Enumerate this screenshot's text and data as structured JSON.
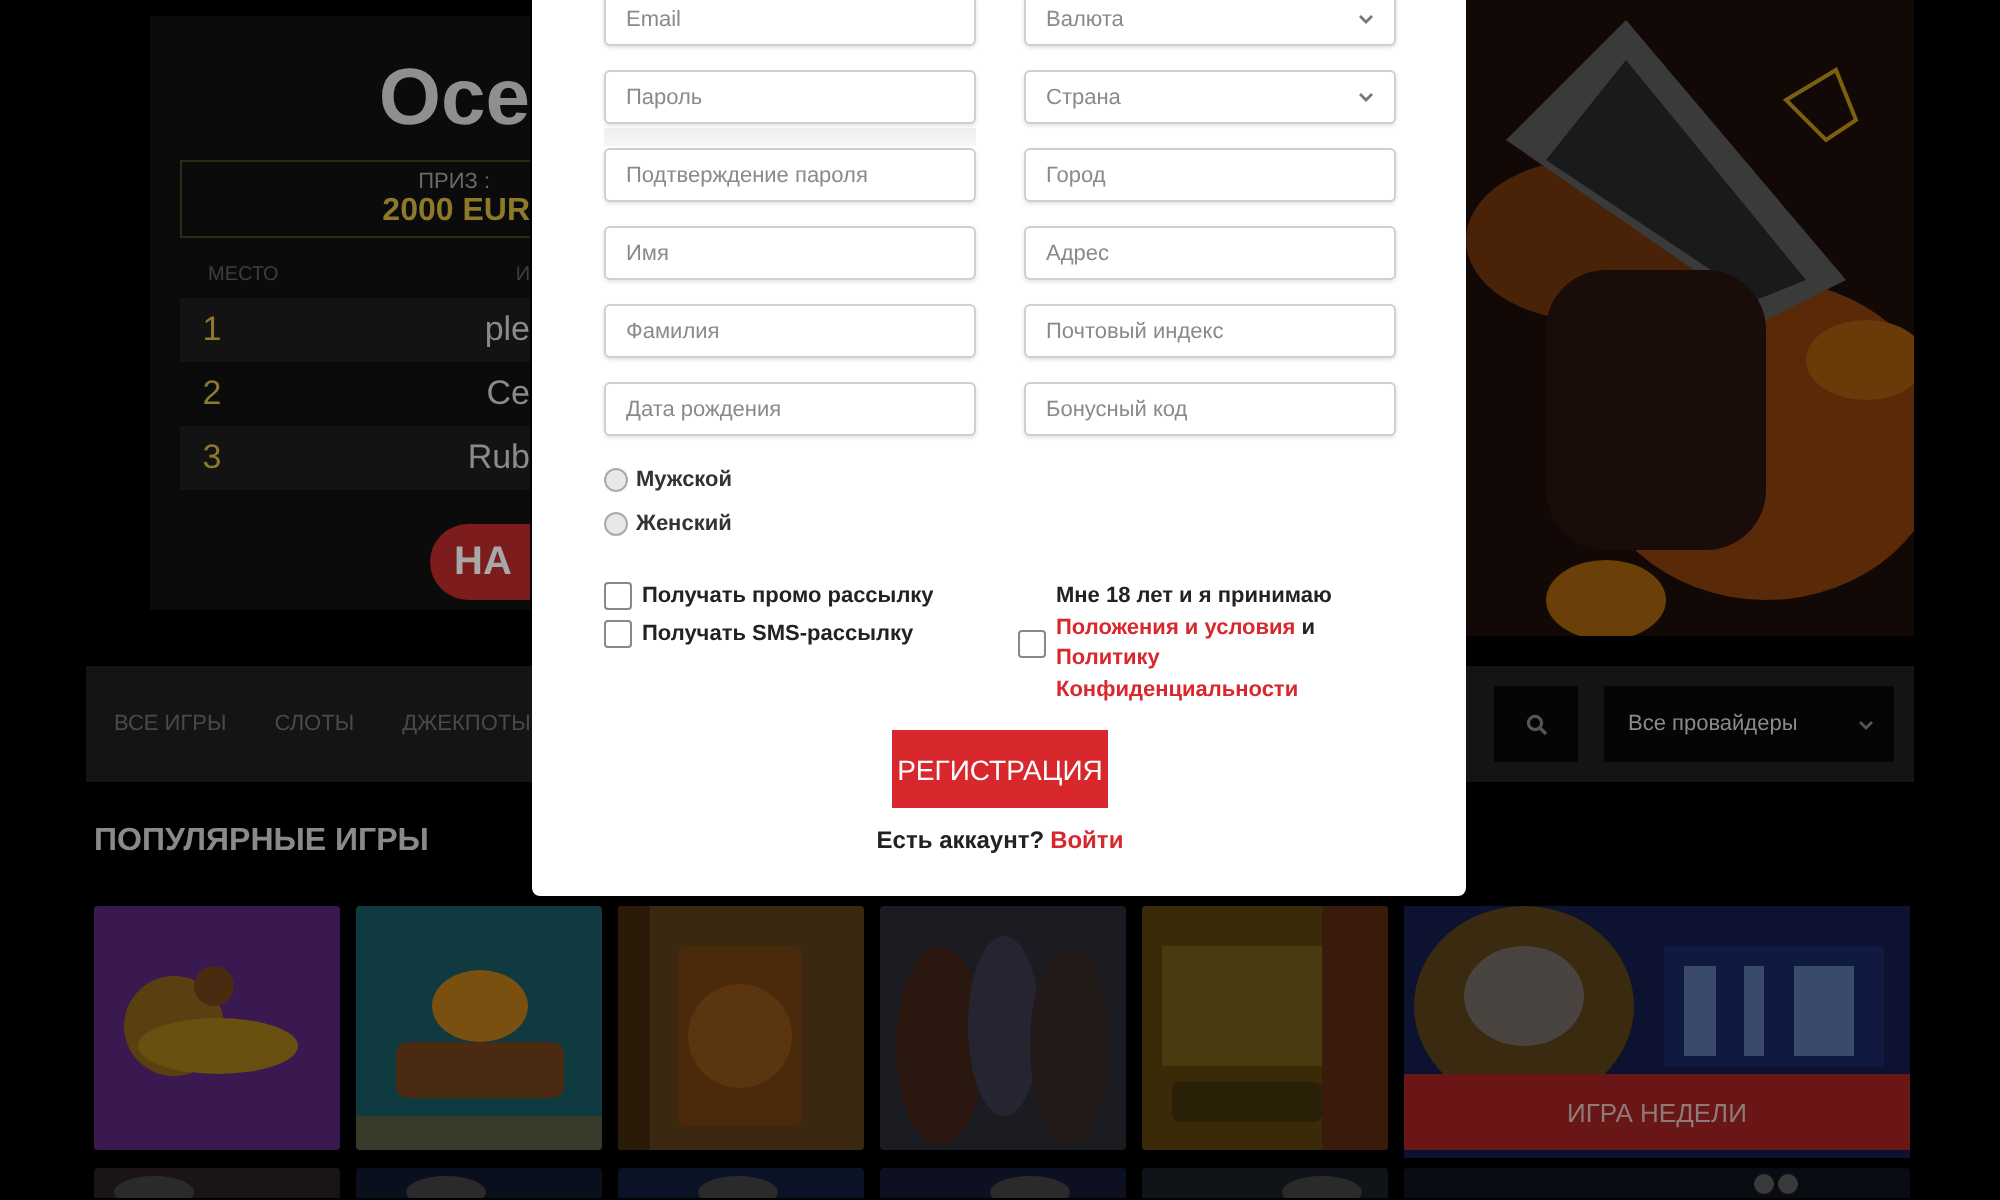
{
  "tournament": {
    "title": "Осе",
    "prize_label": "ПРИЗ :",
    "prize": "2000 EUR",
    "columns": [
      "МЕСТО",
      "И"
    ],
    "rows": [
      {
        "place": "1",
        "name": "ple"
      },
      {
        "place": "2",
        "name": "Ce"
      },
      {
        "place": "3",
        "name": "Rub"
      }
    ],
    "button": "НА"
  },
  "nav": {
    "items": [
      {
        "label": "ВСЕ ИГРЫ"
      },
      {
        "label": "СЛОТЫ"
      },
      {
        "label": "ДЖЕКПОТЫ"
      }
    ],
    "provider_select": "Все провайдеры"
  },
  "section_title": "ПОПУЛЯРНЫЕ ИГРЫ",
  "featured_game": {
    "kind": "picture",
    "badge": "ИГРА НЕДЕЛИ"
  },
  "registration": {
    "fields": [
      {
        "placeholder": "Email",
        "kind": "text"
      },
      {
        "placeholder": "Валюта",
        "kind": "select"
      },
      {
        "placeholder": "Пароль",
        "kind": "password"
      },
      {
        "placeholder": "Страна",
        "kind": "select"
      },
      {
        "placeholder": "Подтверждение пароля",
        "kind": "text"
      },
      {
        "placeholder": "Город",
        "kind": "text"
      },
      {
        "placeholder": "Имя",
        "kind": "text"
      },
      {
        "placeholder": "Адрес",
        "kind": "text"
      },
      {
        "placeholder": "Фамилия",
        "kind": "text"
      },
      {
        "placeholder": "Почтовый индекс",
        "kind": "text"
      },
      {
        "placeholder": "Дата рождения",
        "kind": "text"
      },
      {
        "placeholder": "Бонусный код",
        "kind": "text"
      }
    ],
    "gender": [
      {
        "label": "Мужской",
        "selected": false
      },
      {
        "label": "Женский",
        "selected": false
      }
    ],
    "options": [
      {
        "label": "Получать промо рассылку",
        "checked": false
      },
      {
        "label": "Получать SMS-рассылку",
        "checked": false
      }
    ],
    "terms": {
      "checked": false,
      "text": "Мне 18 лет и я принимаю",
      "link_terms": "Положения и условия",
      "conjunction": "и",
      "link_privacy": "Политику Конфиденциальности"
    },
    "submit": "РЕГИСТРАЦИЯ",
    "login_prompt": "Есть аккаунт?",
    "login_link": "Войти"
  }
}
